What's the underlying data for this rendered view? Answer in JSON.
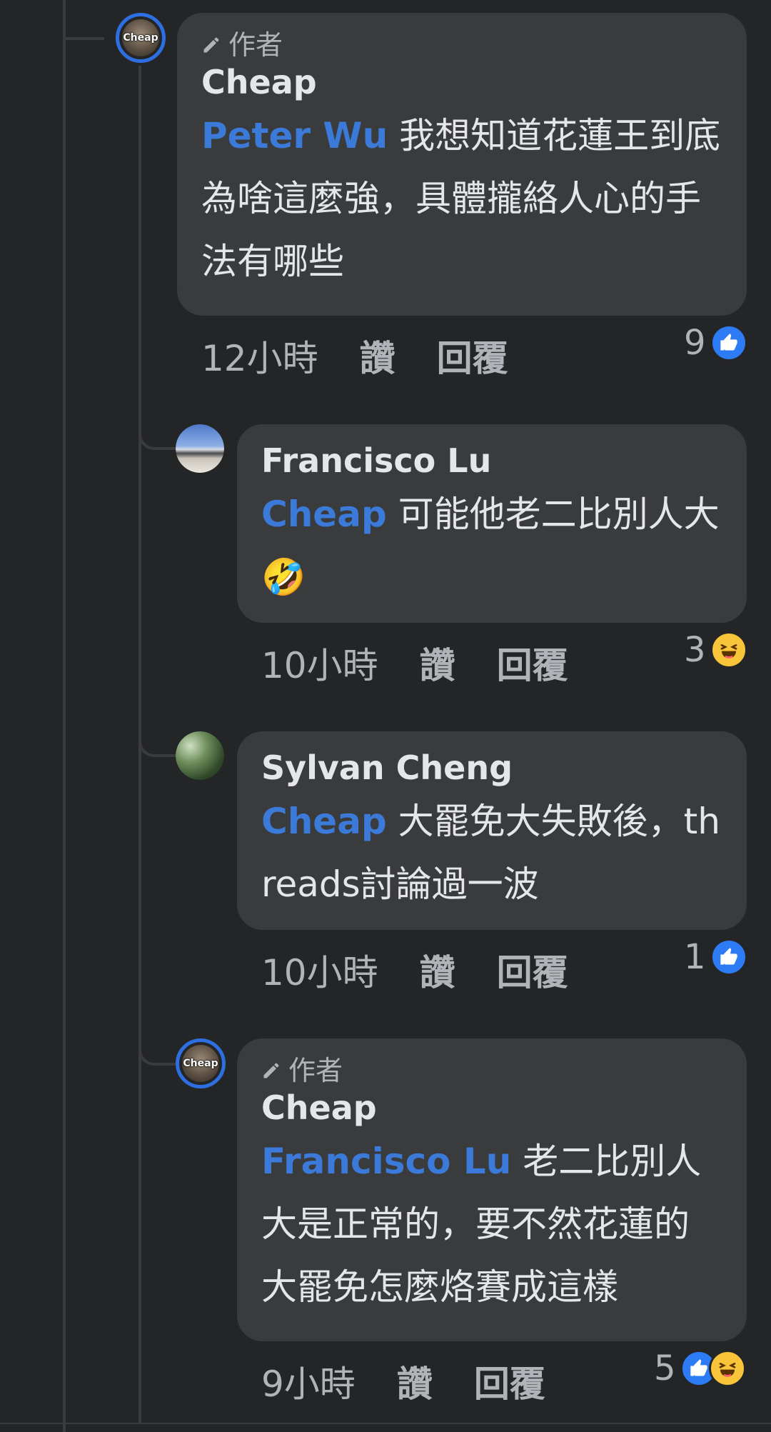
{
  "comments": [
    {
      "author_badge": "作者",
      "name": "Cheap",
      "avatar_text": "Cheap",
      "mention": "Peter Wu",
      "text": "我想知道花蓮王到底為啥這麼強，具體攏絡人心的手法有哪些",
      "time": "12小時",
      "like_label": "讚",
      "reply_label": "回覆",
      "reaction_count": "9",
      "reactions": [
        "like"
      ]
    },
    {
      "name": "Francisco Lu",
      "mention": "Cheap",
      "text": "可能他老二比別人大🤣",
      "time": "10小時",
      "like_label": "讚",
      "reply_label": "回覆",
      "reaction_count": "3",
      "reactions": [
        "haha"
      ]
    },
    {
      "name": "Sylvan Cheng",
      "mention": "Cheap",
      "text": "大罷免大失敗後，threads討論過一波",
      "time": "10小時",
      "like_label": "讚",
      "reply_label": "回覆",
      "reaction_count": "1",
      "reactions": [
        "like"
      ]
    },
    {
      "author_badge": "作者",
      "name": "Cheap",
      "avatar_text": "Cheap",
      "mention": "Francisco Lu",
      "text": "老二比別人大是正常的，要不然花蓮的大罷免怎麼烙賽成這樣",
      "time": "9小時",
      "like_label": "讚",
      "reply_label": "回覆",
      "reaction_count": "5",
      "reactions": [
        "like",
        "haha"
      ]
    }
  ],
  "colors": {
    "background": "#242527",
    "bubble": "#3a3b3c",
    "mention": "#3b7ad9",
    "author_ring": "#2d6fe0",
    "like_blue": "#2d7cf6",
    "haha_yellow": "#f7c43a"
  },
  "icons": {
    "author_badge_icon": "pencil-icon",
    "like_reaction_icon": "thumbs-up-icon",
    "haha_reaction_icon": "laughing-face-icon"
  }
}
